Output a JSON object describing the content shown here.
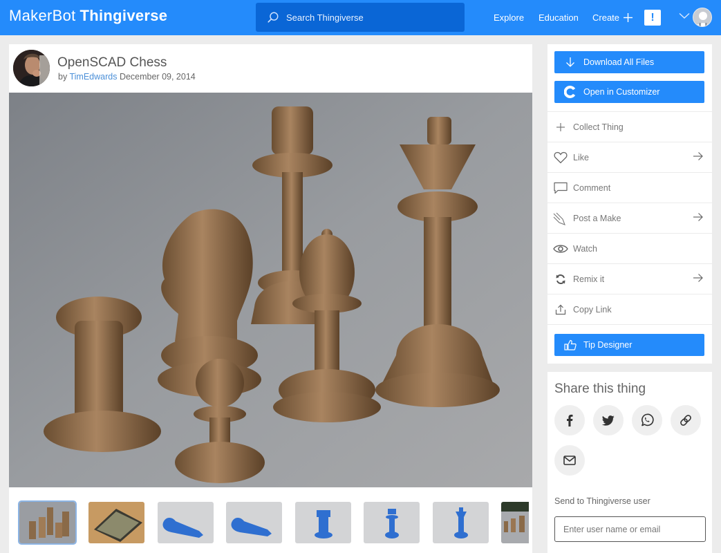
{
  "topbar": {
    "logo_part1": "MakerBot",
    "logo_part2": "Thingiverse",
    "search_placeholder": "Search Thingiverse",
    "nav": [
      {
        "label": "Explore"
      },
      {
        "label": "Education"
      },
      {
        "label": "Create"
      }
    ],
    "alert_symbol": "!",
    "brand_color": "#248bfb"
  },
  "thing": {
    "title": "OpenSCAD Chess",
    "by_prefix": "by",
    "author": "TimEdwards",
    "date": "December 09, 2014",
    "hero_alt": "Photo of bronze-colored 3D printed chess pieces: rook, knight, pawn, king, bishop, queen",
    "thumbnails": [
      {
        "label": "Bronze chess pieces photo",
        "selected": true
      },
      {
        "label": "Chess board with pieces",
        "selected": false
      },
      {
        "label": "Blue king lying on build plate",
        "selected": false
      },
      {
        "label": "Blue queen lying on build plate",
        "selected": false
      },
      {
        "label": "Blue rook render",
        "selected": false
      },
      {
        "label": "Blue queen render",
        "selected": false
      },
      {
        "label": "Blue king render",
        "selected": false
      },
      {
        "label": "Chess pieces photo (partial)",
        "selected": false
      }
    ]
  },
  "sidebar": {
    "download_label": "Download All Files",
    "customizer_label": "Open in Customizer",
    "actions": [
      {
        "label": "Collect Thing",
        "icon": "plus-icon",
        "has_arrow": false
      },
      {
        "label": "Like",
        "icon": "heart-icon",
        "has_arrow": true
      },
      {
        "label": "Comment",
        "icon": "comment-icon",
        "has_arrow": false
      },
      {
        "label": "Post a Make",
        "icon": "make-icon",
        "has_arrow": true
      },
      {
        "label": "Watch",
        "icon": "eye-icon",
        "has_arrow": false
      },
      {
        "label": "Remix it",
        "icon": "remix-icon",
        "has_arrow": true
      },
      {
        "label": "Copy Link",
        "icon": "share-upload-icon",
        "has_arrow": false
      }
    ],
    "tip_label": "Tip Designer"
  },
  "share": {
    "title": "Share this thing",
    "buttons": [
      "facebook",
      "twitter",
      "whatsapp",
      "link",
      "email"
    ],
    "send_label": "Send to Thingiverse user",
    "send_placeholder": "Enter user name or email",
    "send_value": ""
  }
}
